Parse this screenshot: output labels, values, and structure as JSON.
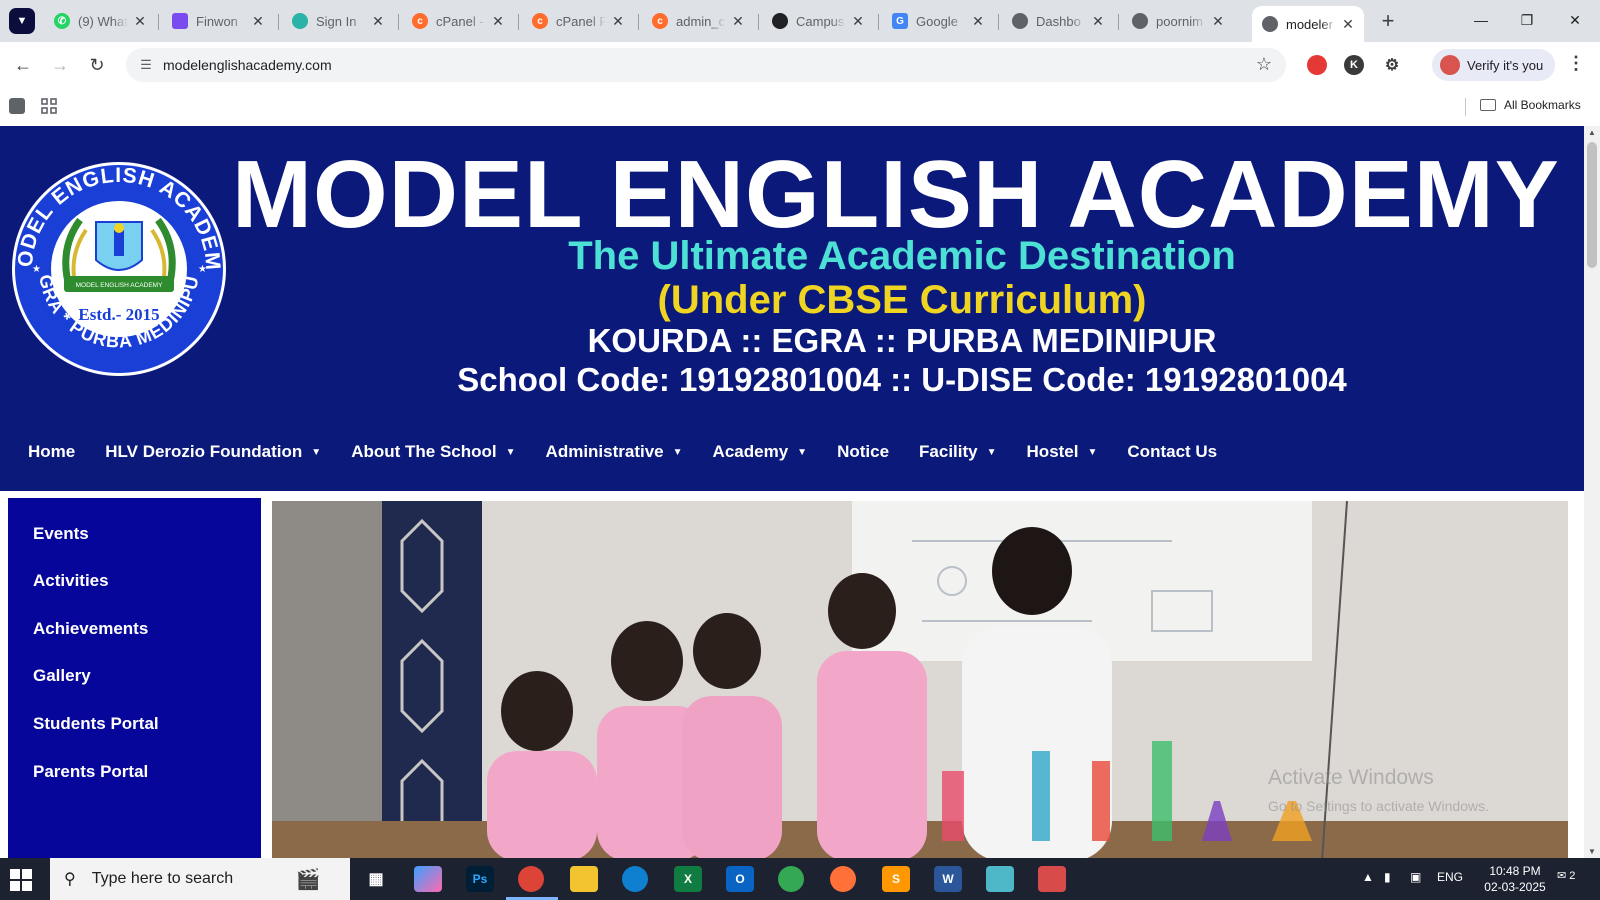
{
  "browser": {
    "tabs": [
      {
        "title": "(9) What",
        "favicon": "whatsapp-icon",
        "color": "#25d366"
      },
      {
        "title": "Finwon",
        "favicon": "finwon-icon",
        "color": "#7a4cf0"
      },
      {
        "title": "Sign In",
        "favicon": "signin-icon",
        "color": "#2ab3a6"
      },
      {
        "title": "cPanel -",
        "favicon": "cpanel-icon",
        "color": "#ff6c2c"
      },
      {
        "title": "cPanel F",
        "favicon": "cpanel-icon",
        "color": "#ff6c2c"
      },
      {
        "title": "admin_c",
        "favicon": "cpanel-icon",
        "color": "#ff6c2c"
      },
      {
        "title": "Campus",
        "favicon": "campus-icon",
        "color": "#202124"
      },
      {
        "title": "Google",
        "favicon": "google-translate-icon",
        "color": "#4285f4"
      },
      {
        "title": "Dashbo",
        "favicon": "globe-icon",
        "color": "#5f6368"
      },
      {
        "title": "poornim",
        "favicon": "globe-icon",
        "color": "#5f6368"
      },
      {
        "title": "modeler",
        "favicon": "globe-icon",
        "color": "#5f6368",
        "active": true
      }
    ],
    "url": "modelenglishacademy.com",
    "verify_label": "Verify it's you",
    "all_bookmarks": "All Bookmarks"
  },
  "site": {
    "logo": {
      "ring_text_top": "MODEL ENGLISH ACADEMY",
      "ring_text_bottom": "EGRA * PURBA MEDINIPUR",
      "banner_text": "MODEL ENGLISH ACADEMY",
      "estd": "Estd.- 2015"
    },
    "title": "MODEL ENGLISH ACADEMY",
    "tagline": "The Ultimate Academic Destination",
    "curriculum": "(Under CBSE Curriculum)",
    "location": "KOURDA :: EGRA :: PURBA MEDINIPUR",
    "codes": "School Code: 19192801004 :: U-DISE Code: 19192801004",
    "nav": [
      {
        "label": "Home",
        "dropdown": false
      },
      {
        "label": "HLV Derozio Foundation",
        "dropdown": true
      },
      {
        "label": "About The School",
        "dropdown": true
      },
      {
        "label": "Administrative",
        "dropdown": true
      },
      {
        "label": "Academy",
        "dropdown": true
      },
      {
        "label": "Notice",
        "dropdown": false
      },
      {
        "label": "Facility",
        "dropdown": true
      },
      {
        "label": "Hostel",
        "dropdown": true
      },
      {
        "label": "Contact Us",
        "dropdown": false
      }
    ],
    "sidebar": [
      {
        "label": "Events"
      },
      {
        "label": "Activities"
      },
      {
        "label": "Achievements"
      },
      {
        "label": "Gallery"
      },
      {
        "label": "Students Portal"
      },
      {
        "label": "Parents Portal"
      }
    ],
    "colors": {
      "header_bg": "#0b1a7a",
      "sidebar_bg": "#06069a",
      "tagline": "#4de0d4",
      "curriculum": "#f0d422"
    }
  },
  "watermark": {
    "line1": "Activate Windows",
    "line2": "Go to Settings to activate Windows."
  },
  "taskbar": {
    "search_placeholder": "Type here to search",
    "language": "ENG",
    "time": "10:48 PM",
    "date": "02-03-2025",
    "notification_count": "2"
  }
}
